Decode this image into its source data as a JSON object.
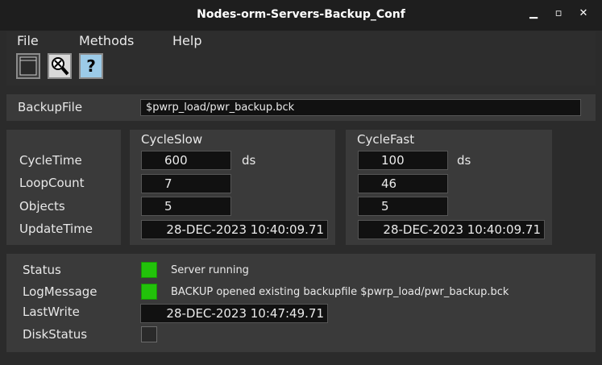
{
  "window": {
    "title": "Nodes-orm-Servers-Backup_Conf"
  },
  "menu": {
    "items": [
      "File",
      "Methods",
      "Help"
    ]
  },
  "toolbar": {
    "icons": [
      "graph-icon",
      "zoom-reset-icon",
      "help-icon"
    ],
    "help_glyph": "?"
  },
  "backup": {
    "label": "BackupFile",
    "value": "$pwrp_load/pwr_backup.bck"
  },
  "cycles": {
    "row_labels": [
      "CycleTime",
      "LoopCount",
      "Objects",
      "UpdateTime"
    ],
    "slow": {
      "title": "CycleSlow",
      "cycle_time": "600",
      "unit": "ds",
      "loop_count": "7",
      "objects": "5",
      "update_time": "28-DEC-2023 10:40:09.71"
    },
    "fast": {
      "title": "CycleFast",
      "cycle_time": "100",
      "unit": "ds",
      "loop_count": "46",
      "objects": "5",
      "update_time": "28-DEC-2023 10:40:09.71"
    }
  },
  "status": {
    "status_label": "Status",
    "status_text": "Server running",
    "status_color": "#22c20a",
    "log_label": "LogMessage",
    "log_text": "BACKUP opened existing backupfile $pwrp_load/pwr_backup.bck",
    "log_color": "#22c20a",
    "last_write_label": "LastWrite",
    "last_write_value": "28-DEC-2023 10:47:49.71",
    "disk_label": "DiskStatus"
  }
}
